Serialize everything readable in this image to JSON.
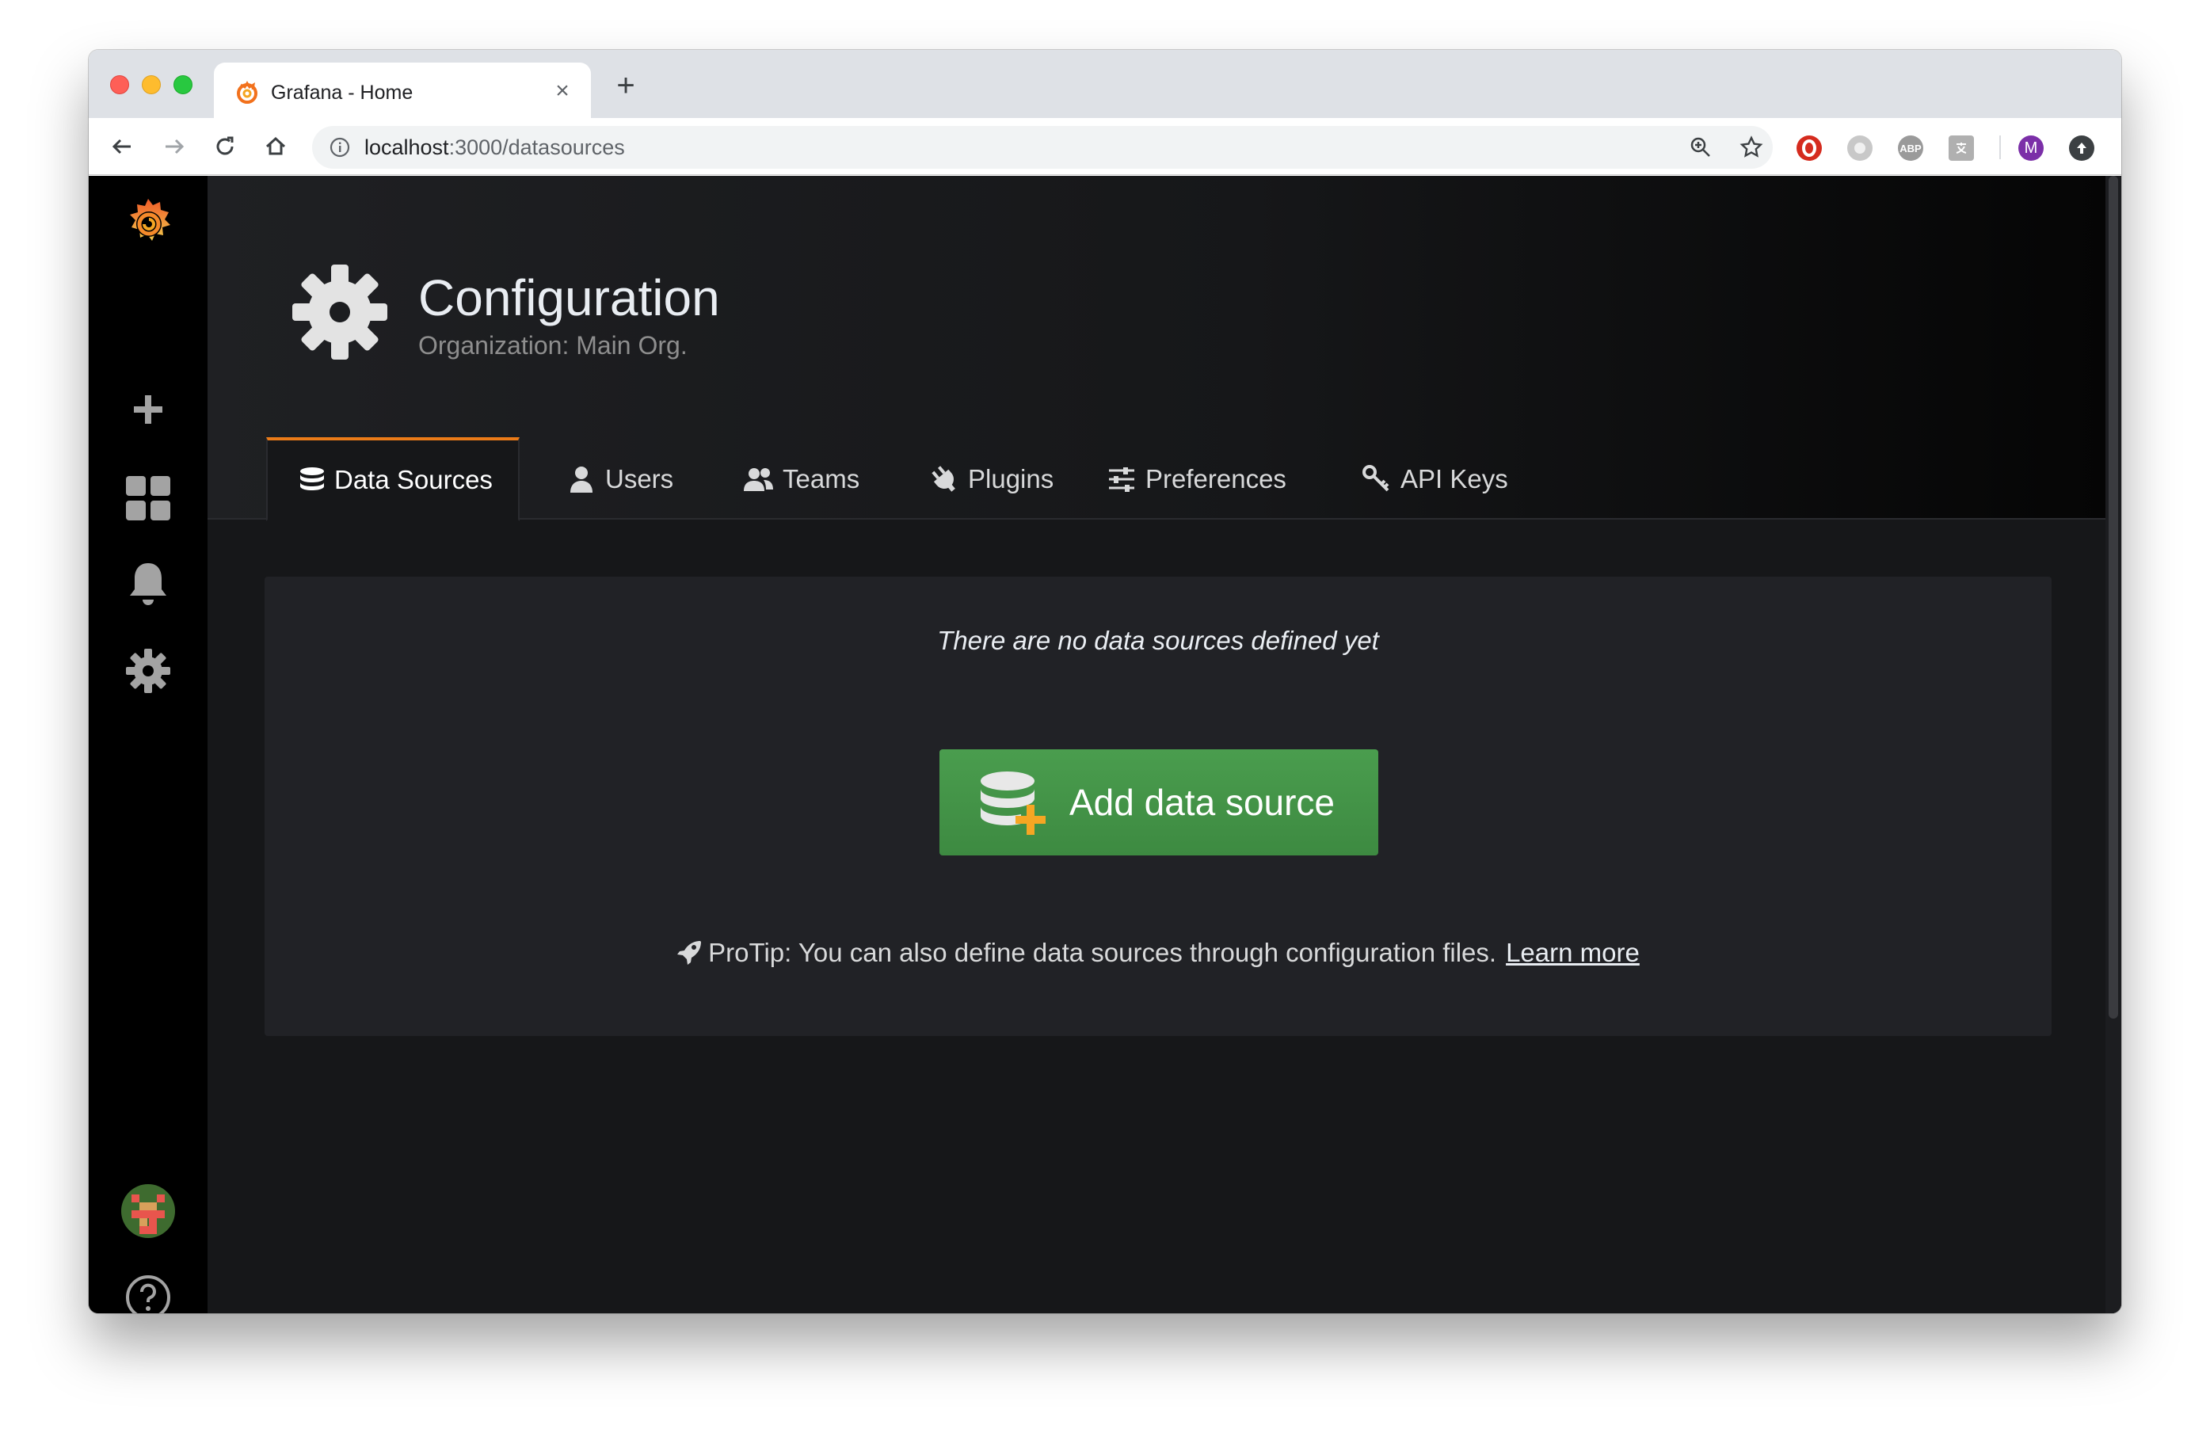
{
  "browser": {
    "tab_title": "Grafana - Home",
    "tab_close": "×",
    "new_tab": "+",
    "url_host": "localhost",
    "url_path": ":3000/datasources",
    "profile_initial": "M",
    "extensions": [
      "opera-icon",
      "circle-icon",
      "ABP",
      "translate-icon"
    ]
  },
  "sidemenu": {
    "items": [
      "grafana-logo",
      "create",
      "dashboards",
      "alerting",
      "configuration",
      "profile",
      "help"
    ]
  },
  "header": {
    "title": "Configuration",
    "subtitle": "Organization: Main Org."
  },
  "tabs": [
    {
      "label": "Data Sources",
      "icon": "database-icon",
      "active": true
    },
    {
      "label": "Users",
      "icon": "user-icon",
      "active": false
    },
    {
      "label": "Teams",
      "icon": "users-icon",
      "active": false
    },
    {
      "label": "Plugins",
      "icon": "plug-icon",
      "active": false
    },
    {
      "label": "Preferences",
      "icon": "sliders-icon",
      "active": false
    },
    {
      "label": "API Keys",
      "icon": "key-icon",
      "active": false
    }
  ],
  "empty": {
    "message": "There are no data sources defined yet",
    "button_label": "Add data source",
    "protip": "ProTip: You can also define data sources through configuration files.",
    "learn_more": "Learn more"
  },
  "colors": {
    "accent": "#eb7b18",
    "button": "#3d8a41",
    "background": "#161719",
    "panel": "#212226"
  }
}
